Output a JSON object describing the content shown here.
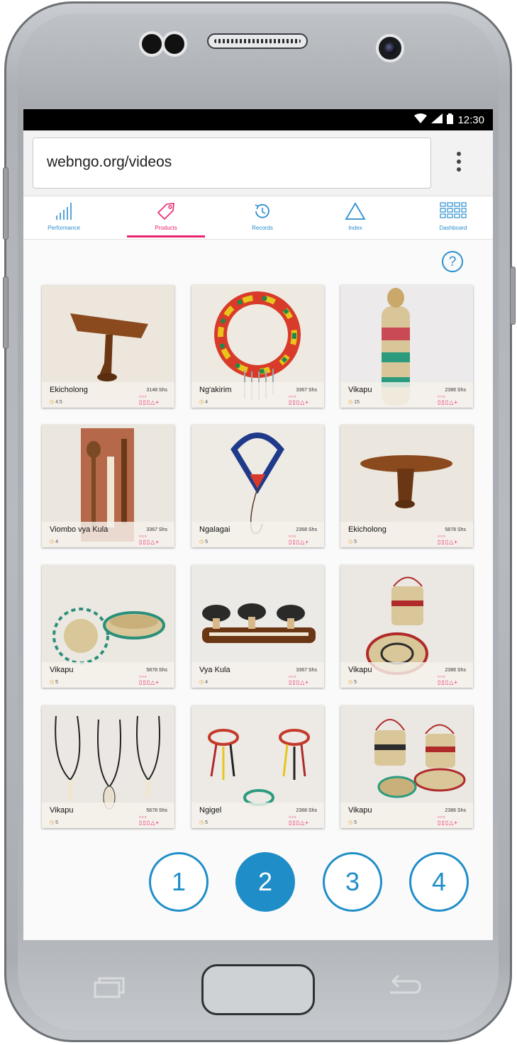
{
  "statusbar": {
    "time": "12:30"
  },
  "browser": {
    "url": "webngo.org/videos"
  },
  "tabs": [
    {
      "label": "Performance",
      "icon": "bar-chart-icon"
    },
    {
      "label": "Products",
      "icon": "tag-icon"
    },
    {
      "label": "Records",
      "icon": "history-icon"
    },
    {
      "label": "Index",
      "icon": "triangle-icon"
    },
    {
      "label": "Dashboard",
      "icon": "grid-icon"
    }
  ],
  "active_tab": "Products",
  "help": {
    "label": "?"
  },
  "products": [
    {
      "name": "Ekicholong",
      "price": "3148 Shs",
      "rating": "4.5",
      "photo": "headrest"
    },
    {
      "name": "Ng'akirim",
      "price": "3367 Shs",
      "rating": "4",
      "photo": "collar"
    },
    {
      "name": "Vikapu",
      "price": "2386 Shs",
      "rating": "15",
      "photo": "tall-basket"
    },
    {
      "name": "Viombo vya Kula",
      "price": "3367 Shs",
      "rating": "4",
      "photo": "utensils"
    },
    {
      "name": "Ngalagai",
      "price": "2368 Shs",
      "rating": "5",
      "photo": "pendant"
    },
    {
      "name": "Ekicholong",
      "price": "5878 Shs",
      "rating": "5",
      "photo": "headrest"
    },
    {
      "name": "Vikapu",
      "price": "5878 Shs",
      "rating": "5",
      "photo": "mat-basket"
    },
    {
      "name": "Vya Kula",
      "price": "3367 Shs",
      "rating": "4",
      "photo": "candle-holder"
    },
    {
      "name": "Vikapu",
      "price": "2386 Shs",
      "rating": "5",
      "photo": "lidded-basket"
    },
    {
      "name": "Vikapu",
      "price": "5678 Shs",
      "rating": "5",
      "photo": "necklaces"
    },
    {
      "name": "Ngigel",
      "price": "2368 Shs",
      "rating": "5",
      "photo": "bracelets"
    },
    {
      "name": "Vikapu",
      "price": "2386 Shs",
      "rating": "5",
      "photo": "basket-set"
    }
  ],
  "pagination": {
    "pages": [
      "1",
      "2",
      "3",
      "4"
    ],
    "active": "2"
  },
  "colors": {
    "accent": "#1f8ec8",
    "active_tab": "#e8246f"
  }
}
